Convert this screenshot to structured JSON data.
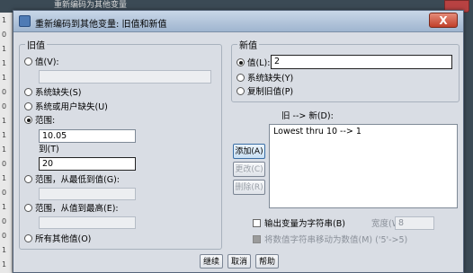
{
  "background": {
    "window_title": "重新编码为其他变量",
    "row_numbers": [
      "1",
      "0",
      "1",
      "1",
      "1",
      "0",
      "0",
      "1",
      "1",
      "1",
      "0",
      "1",
      "0",
      "1",
      "0",
      "0",
      "1",
      "1"
    ]
  },
  "dialog": {
    "title": "重新编码到其他变量: 旧值和新值",
    "close": "X"
  },
  "old_value": {
    "legend": "旧值",
    "value_label": "值(V):",
    "value_input": "",
    "system_missing": "系统缺失(S)",
    "system_or_user_missing": "系统或用户缺失(U)",
    "range_label": "范围:",
    "range_from": "10.05",
    "range_to_label": "到(T)",
    "range_to": "20",
    "range_lowest_label": "范围，从最低到值(G):",
    "range_lowest_input": "",
    "range_highest_label": "范围，从值到最高(E):",
    "range_highest_input": "",
    "all_other": "所有其他值(O)"
  },
  "new_value": {
    "legend": "新值",
    "value_label": "值(L):",
    "value_input": "2",
    "system_missing": "系统缺失(Y)",
    "copy_old": "复制旧值(P)"
  },
  "mapping": {
    "header": "旧 --> 新(D):",
    "items": [
      "Lowest thru 10 --> 1"
    ]
  },
  "list_buttons": {
    "add": "添加(A)",
    "change": "更改(C)",
    "remove": "删除(R)"
  },
  "options": {
    "output_string": "输出变量为字符串(B)",
    "width_label": "宽度(W):",
    "width_value": "8",
    "convert_numeric": "将数值字符串移动为数值(M) ('5'->5)"
  },
  "footer": {
    "continue": "继续",
    "cancel": "取消",
    "help": "帮助"
  }
}
